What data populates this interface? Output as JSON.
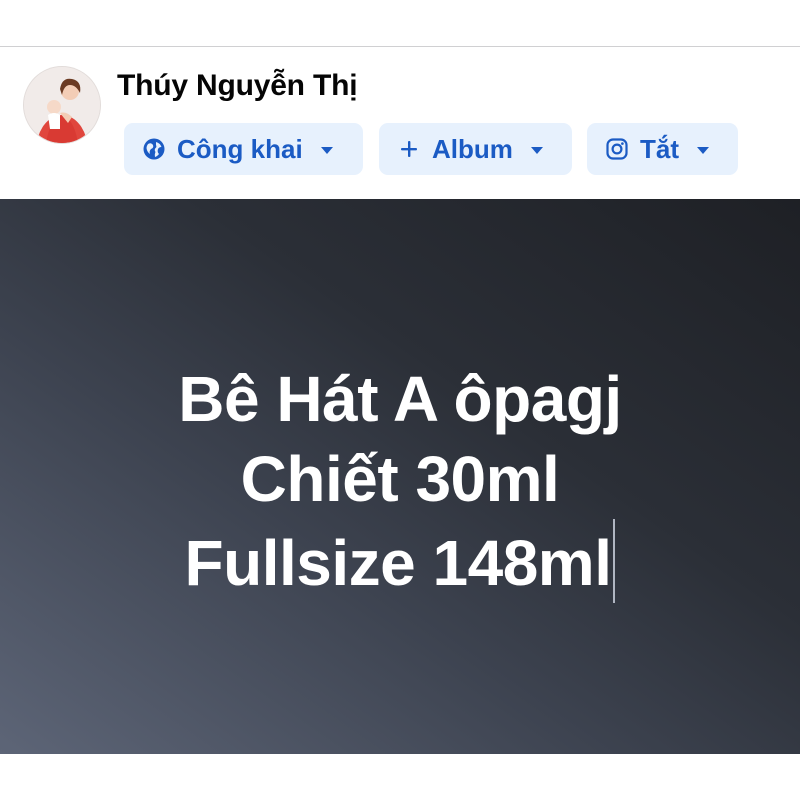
{
  "composer": {
    "user_name": "Thúy Nguyễn Thị",
    "audience_label": "Công khai",
    "album_label": "Album",
    "instagram_label": "Tắt",
    "icons": {
      "audience": "globe-icon",
      "album": "plus-icon",
      "instagram": "instagram-icon",
      "dropdown": "caret-down-icon"
    }
  },
  "text_post": {
    "lines": [
      "Bê Hát A ôpagj",
      "Chiết 30ml",
      "Fullsize 148ml"
    ],
    "background_colors": [
      "#5d6577",
      "#1e2025"
    ],
    "text_color": "#ffffff"
  },
  "colors": {
    "chip_background": "#e7f1fd",
    "chip_text": "#1b5bc4"
  }
}
